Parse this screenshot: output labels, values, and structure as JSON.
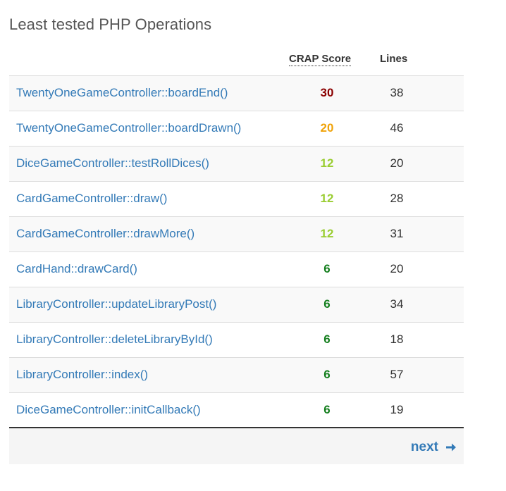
{
  "title": "Least tested PHP Operations",
  "table": {
    "headers": {
      "crap": "CRAP Score",
      "lines": "Lines"
    },
    "rows": [
      {
        "method": "TwentyOneGameController::boardEnd()",
        "score": "30",
        "lines": "38",
        "score_color": "#8b0000"
      },
      {
        "method": "TwentyOneGameController::boardDrawn()",
        "score": "20",
        "lines": "46",
        "score_color": "#f0a30a"
      },
      {
        "method": "DiceGameController::testRollDices()",
        "score": "12",
        "lines": "20",
        "score_color": "#9acd32"
      },
      {
        "method": "CardGameController::draw()",
        "score": "12",
        "lines": "28",
        "score_color": "#9acd32"
      },
      {
        "method": "CardGameController::drawMore()",
        "score": "12",
        "lines": "31",
        "score_color": "#9acd32"
      },
      {
        "method": "CardHand::drawCard()",
        "score": "6",
        "lines": "20",
        "score_color": "#157f1f"
      },
      {
        "method": "LibraryController::updateLibraryPost()",
        "score": "6",
        "lines": "34",
        "score_color": "#157f1f"
      },
      {
        "method": "LibraryController::deleteLibraryById()",
        "score": "6",
        "lines": "18",
        "score_color": "#157f1f"
      },
      {
        "method": "LibraryController::index()",
        "score": "6",
        "lines": "57",
        "score_color": "#157f1f"
      },
      {
        "method": "DiceGameController::initCallback()",
        "score": "6",
        "lines": "19",
        "score_color": "#157f1f"
      }
    ]
  },
  "footer": {
    "next_label": "next",
    "next_icon": "arrow-right-icon"
  },
  "colors": {
    "link": "#337ab7"
  }
}
